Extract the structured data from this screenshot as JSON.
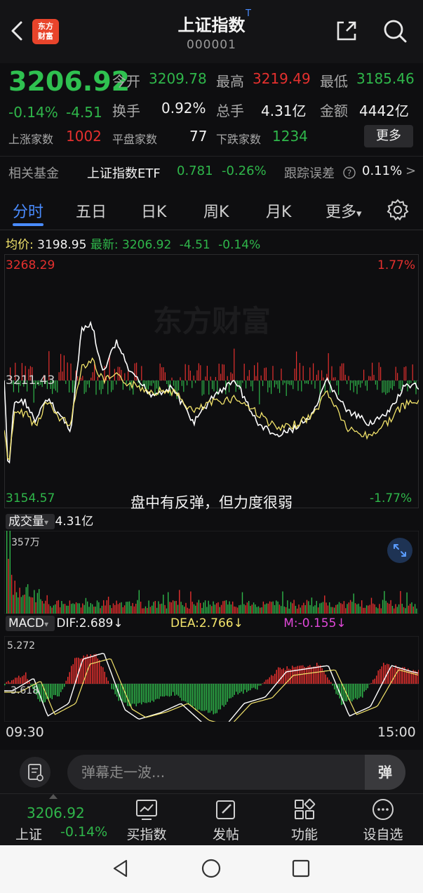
{
  "header": {
    "title": "上证指数",
    "title_badge": "T",
    "code": "000001",
    "logo_line1": "东方",
    "logo_line2": "财富"
  },
  "quote": {
    "price": "3206.92",
    "change_pct": "-0.14%",
    "change": "-4.51",
    "open_label": "今开",
    "open": "3209.78",
    "high_label": "最高",
    "high": "3219.49",
    "low_label": "最低",
    "low": "3185.46",
    "turnover_label": "换手",
    "turnover": "0.92%",
    "volume_label": "总手",
    "volume": "4.31亿",
    "amount_label": "金额",
    "amount": "4442亿",
    "up_count_label": "上涨家数",
    "up_count": "1002",
    "flat_count_label": "平盘家数",
    "flat_count": "77",
    "down_count_label": "下跌家数",
    "down_count": "1234",
    "more_button": "更多"
  },
  "fund": {
    "label": "相关基金",
    "name": "上证指数ETF",
    "price": "0.781",
    "change": "-0.26%",
    "tracking_label": "跟踪误差",
    "tracking_value": "0.11%",
    "arrow": ">"
  },
  "tabs": {
    "t1": "分时",
    "t2": "五日",
    "t3": "日K",
    "t4": "周K",
    "t5": "月K",
    "t6": "更多",
    "dropdown_mark": "▾"
  },
  "info": {
    "avg_label": "均价:",
    "avg": "3198.95",
    "latest_label": "最新:",
    "latest": "3206.92",
    "latest_change": "-4.51",
    "latest_pct": "-0.14%"
  },
  "chart": {
    "top_price": "3268.29",
    "top_pct": "1.77%",
    "mid_price": "3211.43",
    "bottom_price": "3154.57",
    "bottom_pct": "-1.77%",
    "caption": "盘中有反弹，但力度很弱",
    "watermark": "东方财富"
  },
  "volume": {
    "label": "成交量",
    "total": "4.31亿",
    "max_label": "357万"
  },
  "macd": {
    "label": "MACD",
    "dif": "DIF:2.689↓",
    "dea": "DEA:2.766↓",
    "m": "M:-0.155↓",
    "top_value": "5.272",
    "bottom_value": "-3.618",
    "time_start": "09:30",
    "time_end": "15:00"
  },
  "comment": {
    "placeholder": "弹幕走一波...",
    "danmu_button": "弹"
  },
  "bottom_nav": {
    "price": "3206.92",
    "name": "上证",
    "pct": "-0.14%",
    "buy": "买指数",
    "post": "发帖",
    "functions": "功能",
    "watchlist": "设自选"
  },
  "colors": {
    "up": "#e5302e",
    "down": "#2fb64a",
    "accent": "#4a8cff",
    "dea": "#f3e46b",
    "m": "#e048d8"
  }
}
